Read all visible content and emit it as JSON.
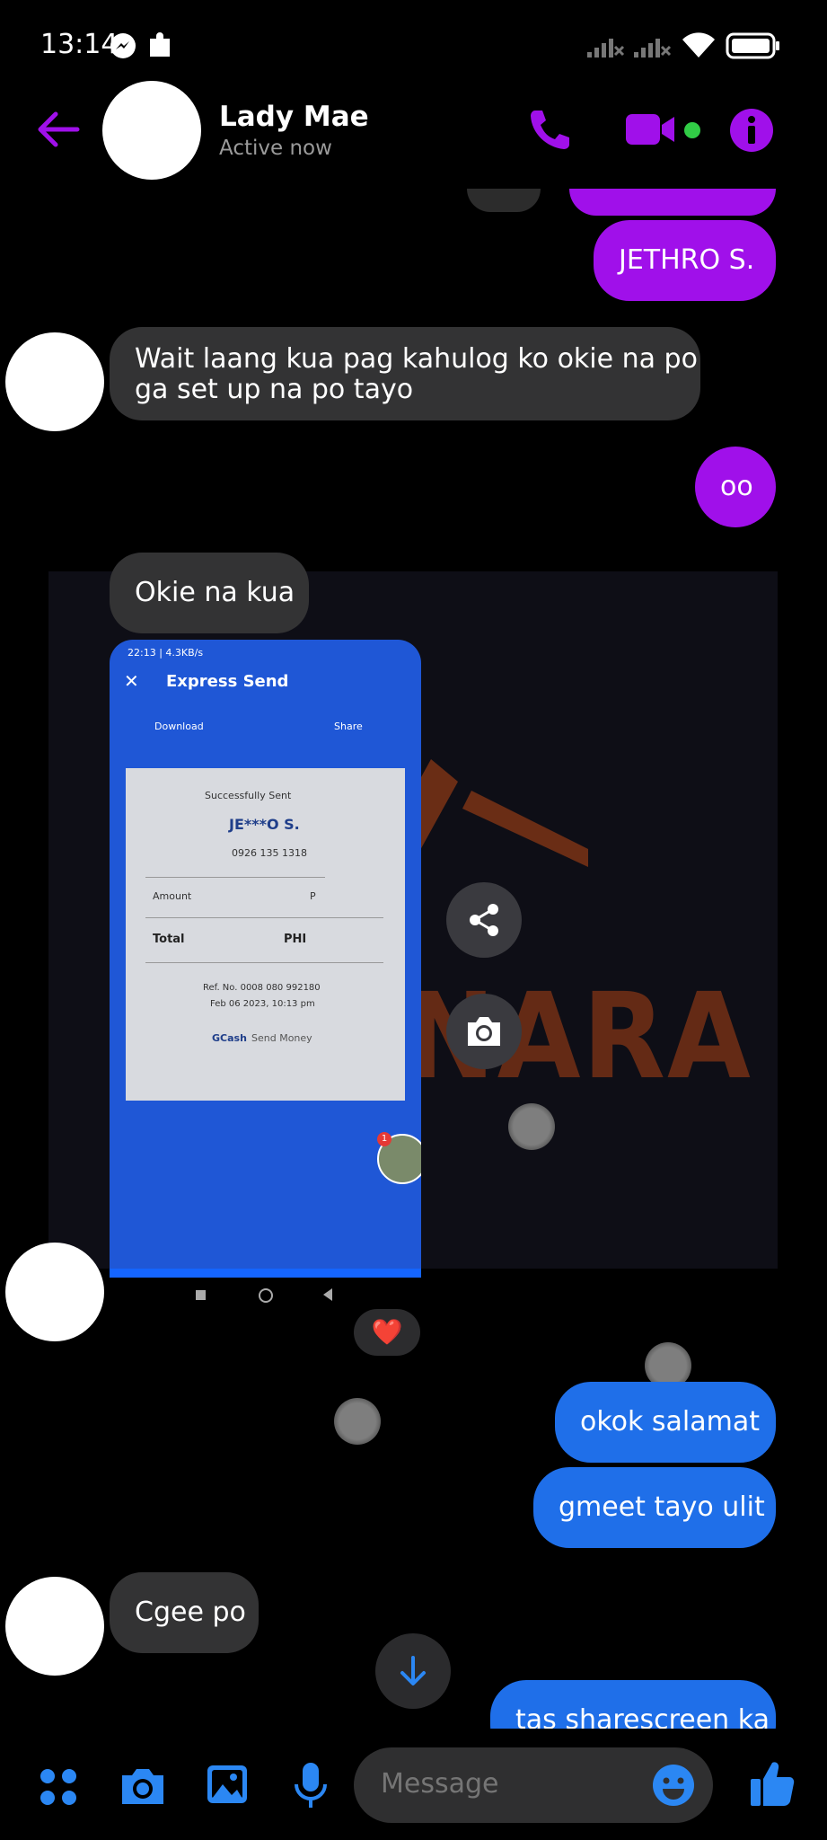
{
  "status_bar": {
    "time": "13:14"
  },
  "header": {
    "contact_name": "Lady Mae",
    "presence": "Active now"
  },
  "messages": {
    "sent_name": "JETHRO S.",
    "received_1": [
      "Wait laang kua pag kahulog ko okie na po",
      "ga set up na po tayo"
    ],
    "sent_oo": "oo",
    "received_2": "Okie na kua",
    "reaction": "❤️",
    "sent_okok": "okok salamat",
    "sent_gmeet": "gmeet tayo ulit",
    "received_3": "Cgee po",
    "sent_partial": "tas sharescreen ka"
  },
  "receipt_screenshot": {
    "phone_status": "22:13 | 4.3KB/s",
    "title": "Express Send",
    "download_label": "Download",
    "share_label": "Share",
    "success_text": "Successfully Sent",
    "recipient": "JE***O S.",
    "phone_number": "0926 135 1318",
    "amount_label": "Amount",
    "amount_value": "P",
    "total_label": "Total",
    "total_value": "PHI",
    "ref_no": "Ref. No. 0008 080 992180",
    "date": "Feb 06 2023, 10:13 pm",
    "footer_brand": "GCash",
    "footer_text": "Send Money",
    "badge_count": "1"
  },
  "watermark": {
    "text": "SANARA"
  },
  "composer": {
    "placeholder": "Message"
  },
  "colors": {
    "accent_purple": "#a010ea",
    "sent_blue": "#1f6fe9",
    "received_grey": "#333334",
    "icon_blue": "#2b87f3",
    "online_green": "#31cc46"
  }
}
